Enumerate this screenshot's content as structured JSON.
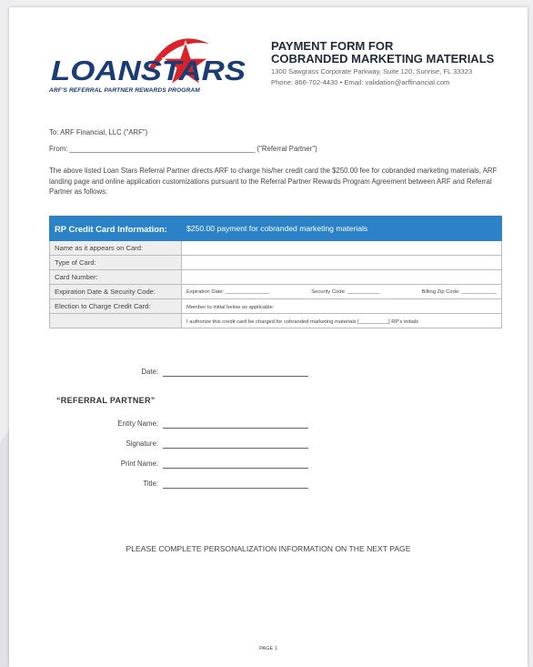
{
  "logo": {
    "wordmark": "LOANSTARS",
    "tagline": "ARF'S REFERRAL PARTNER REWARDS PROGRAM",
    "colors": {
      "blue": "#1a3b73",
      "red": "#d8232a"
    }
  },
  "header": {
    "title_line1": "PAYMENT FORM FOR",
    "title_line2": "COBRANDED MARKETING MATERIALS",
    "address": "1300 Sawgrass Corporate Parkway, Suite 120, Sunrise, FL 33323",
    "contact": "Phone: 866-702-4430 • Email: validation@arffinancial.com"
  },
  "intro": {
    "to": "To: ARF Financial, LLC (\"ARF\")",
    "from": "From: _______________________________________________ (\"Referral Partner\")",
    "paragraph": "The above listed Loan Stars Referral Partner directs ARF to charge his/her credit card the $250.00 fee for cobranded marketing materials, ARF landing page and online application customizations pursuant to the Referral Partner Rewards Program Agreement between ARF and Referral Partner as follows:"
  },
  "table": {
    "header_label": "RP Credit Card Information:",
    "header_value": "$250.00 payment for cobranded marketing materials",
    "header_color": "#2b82c6",
    "rows": {
      "name": "Name as it appears on Card:",
      "type": "Type of Card:",
      "number": "Card Number:",
      "expiration": "Expiration Date & Security Code:",
      "election": "Election to Charge Credit Card:"
    },
    "exp_date": "Expiration Date: _______________",
    "security_code": "Security Code: ___________",
    "billing_zip": "Billing Zip Code: ____________",
    "member_initial": "Member to initial below as applicable:",
    "authorize": "I authorize this credit card be charged for cobranded marketing materials [__________] RP's initials"
  },
  "date_label": "Date:",
  "referral_partner": {
    "heading": "“REFERRAL PARTNER”",
    "entity": "Entity Name:",
    "signature": "Signature:",
    "print_name": "Print Name:",
    "title": "Title:"
  },
  "notice": "PLEASE COMPLETE PERSONALIZATION INFORMATION ON THE NEXT PAGE",
  "page_number": "PAGE 1"
}
